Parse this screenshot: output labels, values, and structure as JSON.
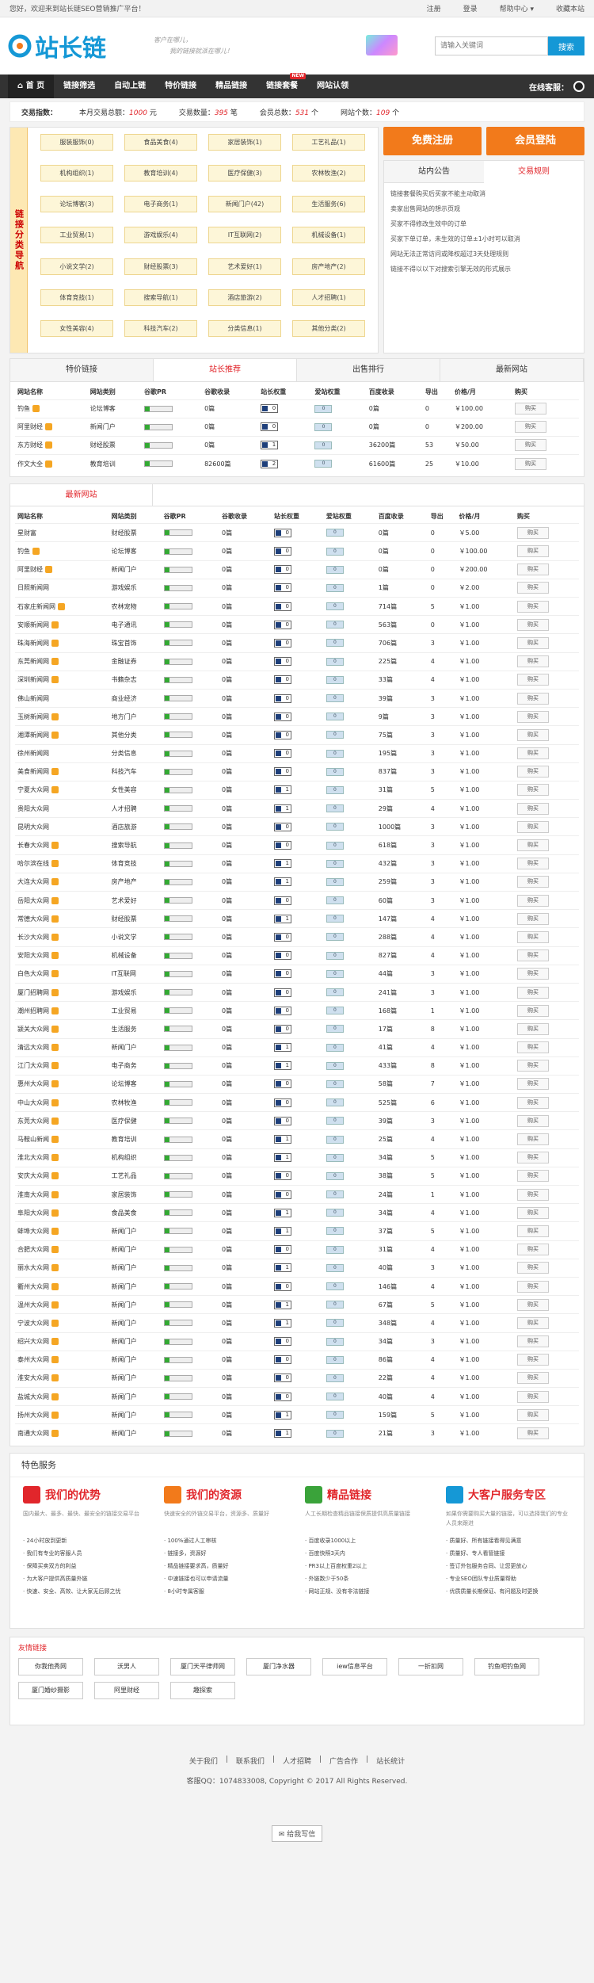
{
  "topbar": {
    "welcome": "您好，欢迎来到站长链SEO营销推广平台！",
    "links": [
      "注册",
      "登录",
      "帮助中心 ▾",
      "收藏本站"
    ]
  },
  "header": {
    "logo_text": "站长链",
    "slogan1": "客户在哪儿，",
    "slogan2": "我的链接就派在哪儿！",
    "search_placeholder": "请输入关键词",
    "search_btn": "搜索"
  },
  "nav": {
    "items": [
      "首 页",
      "链接筛选",
      "自动上链",
      "特价链接",
      "精品链接",
      "链接套餐",
      "网站认领"
    ],
    "new_badge": "NEW",
    "online": "在线客服："
  },
  "stats": {
    "label": "交易指数：",
    "today_label": "本月交易总额：",
    "today_val": "1000",
    "today_unit": "元",
    "count_label": "交易数量：",
    "count_val": "395",
    "count_unit": "笔",
    "member_label": "会员总数：",
    "member_val": "531",
    "member_unit": "个",
    "site_label": "网站个数：",
    "site_val": "109",
    "site_unit": "个"
  },
  "cats": {
    "side": "链接分类导航",
    "items": [
      "服装服饰(0)",
      "食品美食(4)",
      "家居装饰(1)",
      "工艺礼品(1)",
      "机构组织(1)",
      "教育培训(4)",
      "医疗保健(3)",
      "农林牧渔(2)",
      "论坛博客(3)",
      "电子商务(1)",
      "新闻门户(42)",
      "生活服务(6)",
      "工业贸易(1)",
      "游戏娱乐(4)",
      "IT互联网(2)",
      "机械设备(1)",
      "小说文学(2)",
      "财经股票(3)",
      "艺术爱好(1)",
      "房产地产(2)",
      "体育竞技(1)",
      "搜索导航(1)",
      "酒店旅游(2)",
      "人才招聘(1)",
      "女性美容(4)",
      "科技汽车(2)",
      "分类信息(1)",
      "其他分类(2)"
    ]
  },
  "right": {
    "register": "免费注册",
    "login": "会员登陆",
    "tab1": "站内公告",
    "tab2": "交易规则",
    "rules": [
      "链接套餐购买后买家不能主动取消",
      "卖家出售网站的想示页观",
      "买家不得修改生效中的订单",
      "买家下单订单，未生效的订单±1小时可以取消",
      "网站无法正常访问或降权超过3天处理规则",
      "链接不得以以下对搜索引擎无效的形式展示"
    ]
  },
  "tabs": [
    "特价链接",
    "站长推荐",
    "出售排行",
    "最新网站"
  ],
  "columns": [
    "网站名称",
    "网站类别",
    "谷歌PR",
    "谷歌收录",
    "站长权重",
    "爱站权重",
    "百度收录",
    "导出",
    "价格/月",
    "购买"
  ],
  "buy_label": "购买",
  "top_rows": [
    {
      "name": "钓鱼",
      "vip": true,
      "cat": "论坛博客",
      "gpr": "0",
      "gsl": "0篇",
      "bd": "0",
      "aw": "0",
      "bsl": "0篇",
      "out": "0",
      "price": "￥100.00"
    },
    {
      "name": "阿里财经",
      "vip": true,
      "cat": "新闻门户",
      "gpr": "0",
      "gsl": "0篇",
      "bd": "0",
      "aw": "0",
      "bsl": "0篇",
      "out": "0",
      "price": "￥200.00"
    },
    {
      "name": "东方财经",
      "vip": true,
      "cat": "财经股票",
      "gpr": "0",
      "gsl": "0篇",
      "bd": "1",
      "aw": "0",
      "bsl": "36200篇",
      "out": "53",
      "price": "￥50.00"
    },
    {
      "name": "作文大全",
      "vip": true,
      "cat": "教育培训",
      "gpr": "0",
      "gsl": "82600篇",
      "bd": "2",
      "aw": "0",
      "bsl": "61600篇",
      "out": "25",
      "price": "￥10.00"
    }
  ],
  "new_title": "最新网站",
  "rows": [
    {
      "name": "星财富",
      "vip": false,
      "cat": "财经股票",
      "bd": "0",
      "bsl": "0篇",
      "out": "0",
      "price": "￥5.00"
    },
    {
      "name": "钓鱼",
      "vip": true,
      "cat": "论坛博客",
      "bd": "0",
      "bsl": "0篇",
      "out": "0",
      "price": "￥100.00"
    },
    {
      "name": "阿里财经",
      "vip": true,
      "cat": "新闻门户",
      "bd": "0",
      "bsl": "0篇",
      "out": "0",
      "price": "￥200.00"
    },
    {
      "name": "日照新闻网",
      "vip": false,
      "cat": "游戏娱乐",
      "bd": "0",
      "bsl": "1篇",
      "out": "0",
      "price": "￥2.00"
    },
    {
      "name": "石家庄新闻网",
      "vip": true,
      "cat": "农林宠物",
      "bd": "0",
      "bsl": "714篇",
      "out": "5",
      "price": "￥1.00"
    },
    {
      "name": "安顺新闻网",
      "vip": true,
      "cat": "电子通讯",
      "bd": "0",
      "bsl": "563篇",
      "out": "0",
      "price": "￥1.00"
    },
    {
      "name": "珠海新闻网",
      "vip": true,
      "cat": "珠宝首饰",
      "bd": "0",
      "bsl": "706篇",
      "out": "3",
      "price": "￥1.00"
    },
    {
      "name": "东莞新闻网",
      "vip": true,
      "cat": "金融证券",
      "bd": "0",
      "bsl": "225篇",
      "out": "4",
      "price": "￥1.00"
    },
    {
      "name": "深圳新闻网",
      "vip": true,
      "cat": "书籍杂志",
      "bd": "0",
      "bsl": "33篇",
      "out": "4",
      "price": "￥1.00"
    },
    {
      "name": "佛山新闻网",
      "vip": false,
      "cat": "商业经济",
      "bd": "0",
      "bsl": "39篇",
      "out": "3",
      "price": "￥1.00"
    },
    {
      "name": "玉树新闻网",
      "vip": true,
      "cat": "地方门户",
      "bd": "0",
      "bsl": "9篇",
      "out": "3",
      "price": "￥1.00"
    },
    {
      "name": "湘潭新闻网",
      "vip": true,
      "cat": "其他分类",
      "bd": "0",
      "bsl": "75篇",
      "out": "3",
      "price": "￥1.00"
    },
    {
      "name": "徐州新闻网",
      "vip": false,
      "cat": "分类信息",
      "bd": "0",
      "bsl": "195篇",
      "out": "3",
      "price": "￥1.00"
    },
    {
      "name": "美食新闻网",
      "vip": true,
      "cat": "科技汽车",
      "bd": "0",
      "bsl": "837篇",
      "out": "3",
      "price": "￥1.00"
    },
    {
      "name": "宁夏大众网",
      "vip": true,
      "cat": "女性美容",
      "bd": "1",
      "bsl": "31篇",
      "out": "5",
      "price": "￥1.00"
    },
    {
      "name": "贵阳大众网",
      "vip": false,
      "cat": "人才招聘",
      "bd": "1",
      "bsl": "29篇",
      "out": "4",
      "price": "￥1.00"
    },
    {
      "name": "昆明大众网",
      "vip": false,
      "cat": "酒店旅游",
      "bd": "0",
      "bsl": "1000篇",
      "out": "3",
      "price": "￥1.00"
    },
    {
      "name": "长春大众网",
      "vip": true,
      "cat": "搜索导航",
      "bd": "0",
      "bsl": "618篇",
      "out": "3",
      "price": "￥1.00"
    },
    {
      "name": "哈尔滨在线",
      "vip": true,
      "cat": "体育竞技",
      "bd": "1",
      "bsl": "432篇",
      "out": "3",
      "price": "￥1.00"
    },
    {
      "name": "大连大众网",
      "vip": true,
      "cat": "房产地产",
      "bd": "1",
      "bsl": "259篇",
      "out": "3",
      "price": "￥1.00"
    },
    {
      "name": "岳阳大众网",
      "vip": true,
      "cat": "艺术爱好",
      "bd": "0",
      "bsl": "60篇",
      "out": "3",
      "price": "￥1.00"
    },
    {
      "name": "常德大众网",
      "vip": true,
      "cat": "财经股票",
      "bd": "1",
      "bsl": "147篇",
      "out": "4",
      "price": "￥1.00"
    },
    {
      "name": "长沙大众网",
      "vip": true,
      "cat": "小说文学",
      "bd": "0",
      "bsl": "288篇",
      "out": "4",
      "price": "￥1.00"
    },
    {
      "name": "安阳大众网",
      "vip": true,
      "cat": "机械设备",
      "bd": "0",
      "bsl": "827篇",
      "out": "4",
      "price": "￥1.00"
    },
    {
      "name": "白色大众网",
      "vip": true,
      "cat": "IT互联网",
      "bd": "0",
      "bsl": "44篇",
      "out": "3",
      "price": "￥1.00"
    },
    {
      "name": "厦门招聘网",
      "vip": true,
      "cat": "游戏娱乐",
      "bd": "0",
      "bsl": "241篇",
      "out": "3",
      "price": "￥1.00"
    },
    {
      "name": "潮州招聘网",
      "vip": true,
      "cat": "工业贸易",
      "bd": "0",
      "bsl": "168篇",
      "out": "1",
      "price": "￥1.00"
    },
    {
      "name": "颍关大众网",
      "vip": true,
      "cat": "生活服务",
      "bd": "0",
      "bsl": "17篇",
      "out": "8",
      "price": "￥1.00"
    },
    {
      "name": "清远大众网",
      "vip": true,
      "cat": "新闻门户",
      "bd": "1",
      "bsl": "41篇",
      "out": "4",
      "price": "￥1.00"
    },
    {
      "name": "江门大众网",
      "vip": true,
      "cat": "电子商务",
      "bd": "1",
      "bsl": "433篇",
      "out": "8",
      "price": "￥1.00"
    },
    {
      "name": "惠州大众网",
      "vip": true,
      "cat": "论坛博客",
      "bd": "0",
      "bsl": "58篇",
      "out": "7",
      "price": "￥1.00"
    },
    {
      "name": "中山大众网",
      "vip": true,
      "cat": "农林牧渔",
      "bd": "0",
      "bsl": "525篇",
      "out": "6",
      "price": "￥1.00"
    },
    {
      "name": "东莞大众网",
      "vip": true,
      "cat": "医疗保健",
      "bd": "0",
      "bsl": "39篇",
      "out": "3",
      "price": "￥1.00"
    },
    {
      "name": "马鞍山新闻",
      "vip": true,
      "cat": "教育培训",
      "bd": "1",
      "bsl": "25篇",
      "out": "4",
      "price": "￥1.00"
    },
    {
      "name": "淮北大众网",
      "vip": true,
      "cat": "机构组织",
      "bd": "1",
      "bsl": "34篇",
      "out": "5",
      "price": "￥1.00"
    },
    {
      "name": "安庆大众网",
      "vip": true,
      "cat": "工艺礼品",
      "bd": "0",
      "bsl": "38篇",
      "out": "5",
      "price": "￥1.00"
    },
    {
      "name": "淮南大众网",
      "vip": true,
      "cat": "家居装饰",
      "bd": "0",
      "bsl": "24篇",
      "out": "1",
      "price": "￥1.00"
    },
    {
      "name": "阜阳大众网",
      "vip": true,
      "cat": "食品美食",
      "bd": "1",
      "bsl": "34篇",
      "out": "4",
      "price": "￥1.00"
    },
    {
      "name": "蚌埠大众网",
      "vip": true,
      "cat": "新闻门户",
      "bd": "1",
      "bsl": "37篇",
      "out": "5",
      "price": "￥1.00"
    },
    {
      "name": "合肥大众网",
      "vip": true,
      "cat": "新闻门户",
      "bd": "0",
      "bsl": "31篇",
      "out": "4",
      "price": "￥1.00"
    },
    {
      "name": "丽水大众网",
      "vip": true,
      "cat": "新闻门户",
      "bd": "1",
      "bsl": "40篇",
      "out": "3",
      "price": "￥1.00"
    },
    {
      "name": "衢州大众网",
      "vip": true,
      "cat": "新闻门户",
      "bd": "0",
      "bsl": "146篇",
      "out": "4",
      "price": "￥1.00"
    },
    {
      "name": "温州大众网",
      "vip": true,
      "cat": "新闻门户",
      "bd": "1",
      "bsl": "67篇",
      "out": "5",
      "price": "￥1.00"
    },
    {
      "name": "宁波大众网",
      "vip": true,
      "cat": "新闻门户",
      "bd": "1",
      "bsl": "348篇",
      "out": "4",
      "price": "￥1.00"
    },
    {
      "name": "绍兴大众网",
      "vip": true,
      "cat": "新闻门户",
      "bd": "0",
      "bsl": "34篇",
      "out": "3",
      "price": "￥1.00"
    },
    {
      "name": "泰州大众网",
      "vip": true,
      "cat": "新闻门户",
      "bd": "0",
      "bsl": "86篇",
      "out": "4",
      "price": "￥1.00"
    },
    {
      "name": "淮安大众网",
      "vip": true,
      "cat": "新闻门户",
      "bd": "0",
      "bsl": "22篇",
      "out": "4",
      "price": "￥1.00"
    },
    {
      "name": "盐城大众网",
      "vip": true,
      "cat": "新闻门户",
      "bd": "0",
      "bsl": "40篇",
      "out": "4",
      "price": "￥1.00"
    },
    {
      "name": "扬州大众网",
      "vip": true,
      "cat": "新闻门户",
      "bd": "1",
      "bsl": "159篇",
      "out": "5",
      "price": "￥1.00"
    },
    {
      "name": "南通大众网",
      "vip": true,
      "cat": "新闻门户",
      "bd": "1",
      "bsl": "21篇",
      "out": "3",
      "price": "￥1.00"
    }
  ],
  "special": {
    "title": "特色服务",
    "cols": [
      {
        "title": "我们的优势",
        "color": "#e1262b",
        "desc": "国内最大、最多、最快、最安全的链接交易平台",
        "items": [
          "24小时放到更新",
          "我们有专业的客服人员",
          "保障买卖双方的利益",
          "为大客户提供高质量外链",
          "快速、安全、高效、让大家无后顾之忧"
        ]
      },
      {
        "title": "我们的资源",
        "color": "#f27a1b",
        "desc": "快速安全的外链交易平台，资源多、质量好",
        "items": [
          "100%通过人工审核",
          "链接多，资源好",
          "精品链接要求高，质量好",
          "中速链接也可以申请流量",
          "8小时专属客服"
        ]
      },
      {
        "title": "精品链接",
        "color": "#3aa33a",
        "desc": "人工长期检查精品链接保质提供高质量链接",
        "items": [
          "百度收录1000以上",
          "百度快照3天内",
          "PR3以上百度权重2以上",
          "外链数少于50条",
          "网站正规、没有非法链接"
        ]
      },
      {
        "title": "大客户服务专区",
        "color": "#1598d6",
        "desc": "如果你需要购买大量的链接，可以选择我们的专业人员来跟进",
        "items": [
          "质量好、所有链接看得见满意",
          "质量好、专人看管链接",
          "签订外包服务合同、让您更放心",
          "专业SEO团队专业质量帮助",
          "优质质量长期保证、有问题及时更换"
        ]
      }
    ]
  },
  "friends": {
    "title": "友情链接",
    "links": [
      "你我他秀网",
      "沃男人",
      "厦门天平律师网",
      "厦门净水器",
      "iew信息平台",
      "一折扣网",
      "钓鱼吧钓鱼网",
      "厦门婚纱摄影",
      "阿里财经",
      "趣探索"
    ]
  },
  "footer": {
    "links": [
      "关于我们",
      "联系我们",
      "人才招聘",
      "广告合作",
      "站长统计"
    ],
    "copyright": "客服QQ：1074833008, Copyright © 2017 All Rights Reserved.",
    "share": "给我写信"
  }
}
